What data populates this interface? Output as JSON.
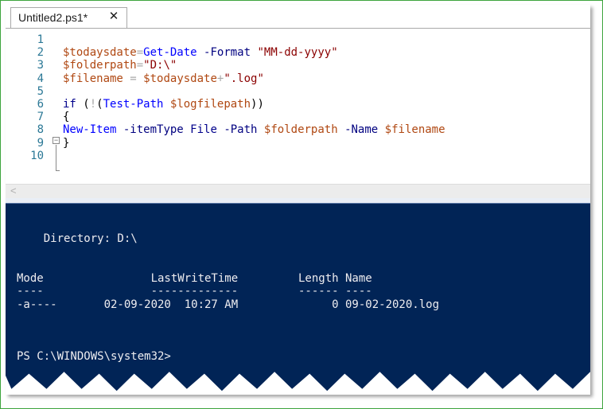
{
  "tab": {
    "title": "Untitled2.ps1*",
    "close_glyph": "✕"
  },
  "editor": {
    "line_numbers": [
      "1",
      "2",
      "3",
      "4",
      "5",
      "6",
      "7",
      "8",
      "9",
      "10"
    ],
    "lines": [
      [],
      [
        [
          "var",
          "$todaysdate"
        ],
        [
          "op",
          "="
        ],
        [
          "cmd",
          "Get-Date"
        ],
        [
          "plain",
          " "
        ],
        [
          "param",
          "-Format"
        ],
        [
          "plain",
          " "
        ],
        [
          "str",
          "\"MM-dd-yyyy\""
        ]
      ],
      [
        [
          "var",
          "$folderpath"
        ],
        [
          "op",
          "="
        ],
        [
          "str",
          "\"D:\\\""
        ]
      ],
      [
        [
          "var",
          "$filename"
        ],
        [
          "plain",
          " "
        ],
        [
          "op",
          "="
        ],
        [
          "plain",
          " "
        ],
        [
          "var",
          "$todaysdate"
        ],
        [
          "op",
          "+"
        ],
        [
          "str",
          "\".log\""
        ]
      ],
      [],
      [
        [
          "kw",
          "if"
        ],
        [
          "plain",
          " ("
        ],
        [
          "op",
          "!"
        ],
        [
          "plain",
          "("
        ],
        [
          "cmd",
          "Test-Path"
        ],
        [
          "plain",
          " "
        ],
        [
          "var",
          "$logfilepath"
        ],
        [
          "plain",
          "))"
        ]
      ],
      [
        [
          "plain",
          "{"
        ]
      ],
      [
        [
          "cmd",
          "New-Item"
        ],
        [
          "plain",
          " "
        ],
        [
          "param",
          "-itemType"
        ],
        [
          "plain",
          " "
        ],
        [
          "kw",
          "File"
        ],
        [
          "plain",
          " "
        ],
        [
          "param",
          "-Path"
        ],
        [
          "plain",
          " "
        ],
        [
          "var",
          "$folderpath"
        ],
        [
          "plain",
          " "
        ],
        [
          "param",
          "-Name"
        ],
        [
          "plain",
          " "
        ],
        [
          "var",
          "$filename"
        ]
      ],
      [
        [
          "plain",
          "}"
        ]
      ],
      []
    ],
    "fold_glyph": "−",
    "scroll_left_glyph": "<"
  },
  "console": {
    "directory_line": "    Directory: D:\\",
    "header_line": "Mode                LastWriteTime         Length Name",
    "separator_line": "----                -------------         ------ ----",
    "row_line": "-a----       02-09-2020  10:27 AM              0 09-02-2020.log",
    "prompt": "PS C:\\WINDOWS\\system32>"
  },
  "colors": {
    "console_bg": "#012456",
    "console_fg": "#eeedf0",
    "frame_border": "#3da43d"
  }
}
